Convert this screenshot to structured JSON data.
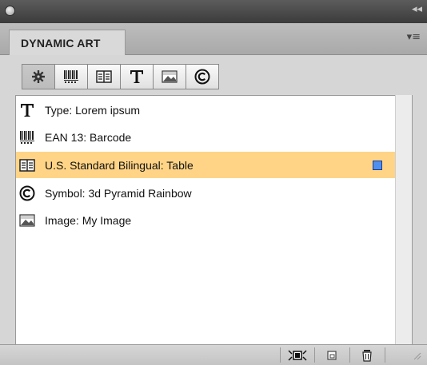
{
  "panel": {
    "tab_title": "DYNAMIC ART",
    "filters": [
      "settings-icon",
      "barcode-icon",
      "table-icon",
      "type-icon",
      "image-icon",
      "symbol-icon"
    ]
  },
  "items": [
    {
      "icon": "type-icon",
      "label": "Type: Lorem ipsum",
      "selected": false
    },
    {
      "icon": "barcode-icon",
      "label": "EAN 13: Barcode",
      "selected": false
    },
    {
      "icon": "table-icon",
      "label": "U.S. Standard Bilingual: Table",
      "selected": true
    },
    {
      "icon": "symbol-icon",
      "label": "Symbol: 3d Pyramid Rainbow",
      "selected": false
    },
    {
      "icon": "image-icon",
      "label": "Image: My Image",
      "selected": false
    }
  ],
  "colors": {
    "selection": "#ffd486",
    "marker": "#4f8ff0"
  }
}
